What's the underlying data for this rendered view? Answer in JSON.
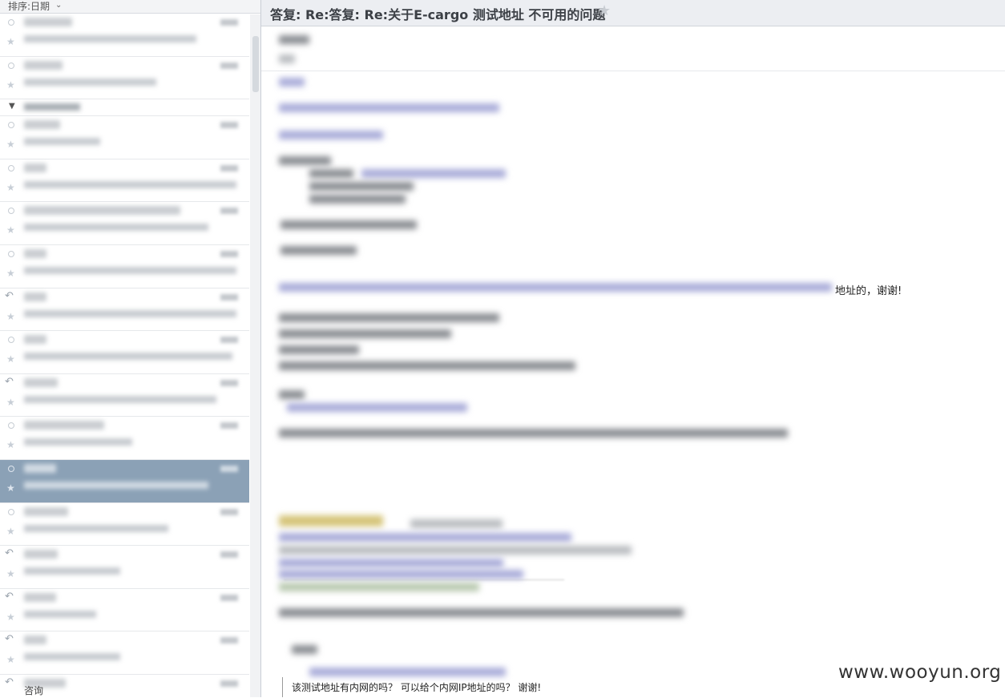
{
  "sort_label": "排序:日期",
  "folder_footer": "咨询",
  "message": {
    "subject": "答复: Re:答复: Re:关于E-cargo  测试地址 不可用的问题",
    "visible_line": "地址的，谢谢!",
    "bottom_line": "该测试地址有内网的吗？ 可以给个内网IP地址的吗？ 谢谢!"
  },
  "watermark": "www.wooyun.org",
  "icons": {
    "sort_chevron": "chevron-down-icon",
    "star": "star-icon",
    "reply": "reply-icon",
    "group_toggle": "triangle-down-icon"
  },
  "colors": {
    "selected_row": "#8ba1b6",
    "header_bg": "#eceef2"
  }
}
